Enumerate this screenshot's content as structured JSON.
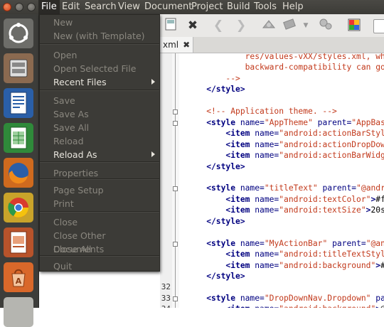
{
  "menubar": {
    "items": [
      "File",
      "Edit",
      "Search",
      "View",
      "Document",
      "Project",
      "Build",
      "Tools",
      "Help"
    ]
  },
  "launcher": {
    "apps": [
      "ubuntu-dash-icon",
      "file-manager-icon",
      "writer-icon",
      "calc-icon",
      "firefox-icon",
      "chrome-icon",
      "impress-icon",
      "software-center-icon"
    ]
  },
  "toolbar": {
    "icons": [
      "close-file-icon",
      "back-icon",
      "forward-icon",
      "compile-icon",
      "build-icon",
      "dropdown-icon",
      "execute-icon",
      "color-chooser-icon"
    ]
  },
  "tab": {
    "label": "xml",
    "close": "✖"
  },
  "file_menu": {
    "items": [
      {
        "label": "New",
        "enabled": false
      },
      {
        "label": "New (with Template)",
        "enabled": false
      },
      {
        "label": "Open",
        "enabled": false
      },
      {
        "label": "Open Selected File",
        "enabled": false
      },
      {
        "label": "Recent Files",
        "enabled": true,
        "submenu": true
      },
      {
        "label": "Save",
        "enabled": false
      },
      {
        "label": "Save As",
        "enabled": false
      },
      {
        "label": "Save All",
        "enabled": false
      },
      {
        "label": "Reload",
        "enabled": false
      },
      {
        "label": "Reload As",
        "enabled": true,
        "submenu": true
      },
      {
        "label": "Properties",
        "enabled": false
      },
      {
        "label": "Page Setup",
        "enabled": false
      },
      {
        "label": "Print",
        "enabled": false
      },
      {
        "label": "Close",
        "enabled": false
      },
      {
        "label": "Close Other Documents",
        "enabled": false
      },
      {
        "label": "Close All",
        "enabled": false
      },
      {
        "label": "Quit",
        "enabled": false
      }
    ]
  },
  "editor": {
    "lines": [
      {
        "num": "",
        "parts": [
          [
            "cmt",
            "            res/values-vXX/styles.xml, while c"
          ]
        ]
      },
      {
        "num": "",
        "parts": [
          [
            "cmt",
            "            backward-compatibility can go here"
          ]
        ]
      },
      {
        "num": "",
        "parts": [
          [
            "cmt",
            "        -->"
          ]
        ]
      },
      {
        "num": "",
        "parts": [
          [
            "tag",
            "    </style>"
          ]
        ]
      },
      {
        "num": "",
        "parts": [
          [
            "txt",
            ""
          ]
        ]
      },
      {
        "num": "",
        "parts": [
          [
            "cmt",
            "    <!-- Application theme. -->"
          ]
        ]
      },
      {
        "num": "",
        "parts": [
          [
            "tag",
            "    <style "
          ],
          [
            "attr",
            "name="
          ],
          [
            "str",
            "\"AppTheme\""
          ],
          [
            "attr",
            " parent="
          ],
          [
            "str",
            "\"AppBaseThem"
          ]
        ]
      },
      {
        "num": "",
        "parts": [
          [
            "tag",
            "        <item "
          ],
          [
            "attr",
            "name="
          ],
          [
            "str",
            "\"android:actionBarStyle\""
          ],
          [
            "tag",
            ">"
          ],
          [
            "txt",
            "@s"
          ]
        ]
      },
      {
        "num": "",
        "parts": [
          [
            "tag",
            "        <item "
          ],
          [
            "attr",
            "name="
          ],
          [
            "str",
            "\"android:actionDropDownStyl"
          ]
        ]
      },
      {
        "num": "",
        "parts": [
          [
            "tag",
            "        <item "
          ],
          [
            "attr",
            "name="
          ],
          [
            "str",
            "\"android:actionBarWidgetThe"
          ]
        ]
      },
      {
        "num": "",
        "parts": [
          [
            "tag",
            "    </style>"
          ]
        ]
      },
      {
        "num": "",
        "parts": [
          [
            "txt",
            ""
          ]
        ]
      },
      {
        "num": "",
        "parts": [
          [
            "tag",
            "    <style "
          ],
          [
            "attr",
            "name="
          ],
          [
            "str",
            "\"titleText\""
          ],
          [
            "attr",
            " parent="
          ],
          [
            "str",
            "\"@android:s"
          ]
        ]
      },
      {
        "num": "",
        "parts": [
          [
            "tag",
            "        <item "
          ],
          [
            "attr",
            "name="
          ],
          [
            "str",
            "\"android:textColor\""
          ],
          [
            "tag",
            ">"
          ],
          [
            "txt",
            "#ffffff"
          ]
        ]
      },
      {
        "num": "",
        "parts": [
          [
            "tag",
            "        <item "
          ],
          [
            "attr",
            "name="
          ],
          [
            "str",
            "\"android:textSize\""
          ],
          [
            "tag",
            ">"
          ],
          [
            "txt",
            "20sp</it"
          ]
        ]
      },
      {
        "num": "",
        "parts": [
          [
            "tag",
            "    </style>"
          ]
        ]
      },
      {
        "num": "",
        "parts": [
          [
            "txt",
            ""
          ]
        ]
      },
      {
        "num": "",
        "parts": [
          [
            "tag",
            "    <style "
          ],
          [
            "attr",
            "name="
          ],
          [
            "str",
            "\"MyActionBar\""
          ],
          [
            "attr",
            " parent="
          ],
          [
            "str",
            "\"@android"
          ]
        ]
      },
      {
        "num": "",
        "parts": [
          [
            "tag",
            "        <item "
          ],
          [
            "attr",
            "name="
          ],
          [
            "str",
            "\"android:titleTextStyle\""
          ],
          [
            "tag",
            ">"
          ],
          [
            "txt",
            "@s"
          ]
        ]
      },
      {
        "num": "",
        "parts": [
          [
            "tag",
            "        <item "
          ],
          [
            "attr",
            "name="
          ],
          [
            "str",
            "\"android:background\""
          ],
          [
            "tag",
            ">"
          ],
          [
            "txt",
            "#33b5e"
          ]
        ]
      },
      {
        "num": "",
        "parts": [
          [
            "tag",
            "    </style>"
          ]
        ]
      },
      {
        "num": "32",
        "parts": [
          [
            "txt",
            ""
          ]
        ]
      },
      {
        "num": "33",
        "parts": [
          [
            "tag",
            "    <style "
          ],
          [
            "attr",
            "name="
          ],
          [
            "str",
            "\"DropDownNav.Dropdown\""
          ],
          [
            "attr",
            " parent="
          ]
        ]
      },
      {
        "num": "34",
        "parts": [
          [
            "tag",
            "        <item "
          ],
          [
            "attr",
            "name="
          ],
          [
            "str",
            "\"android:background\""
          ],
          [
            "tag",
            ">"
          ],
          [
            "txt",
            "@drawa"
          ]
        ]
      },
      {
        "num": "35",
        "parts": [
          [
            "tag",
            "        <item "
          ],
          [
            "attr",
            "name="
          ],
          [
            "str",
            "\"android:popupBackground\""
          ],
          [
            "tag",
            ">"
          ],
          [
            "txt",
            "@"
          ]
        ]
      },
      {
        "num": "",
        "parts": [
          [
            "tag",
            "        <item "
          ],
          [
            "attr",
            "name="
          ],
          [
            "str",
            "\"android:dropDownSelector\""
          ]
        ]
      }
    ]
  }
}
